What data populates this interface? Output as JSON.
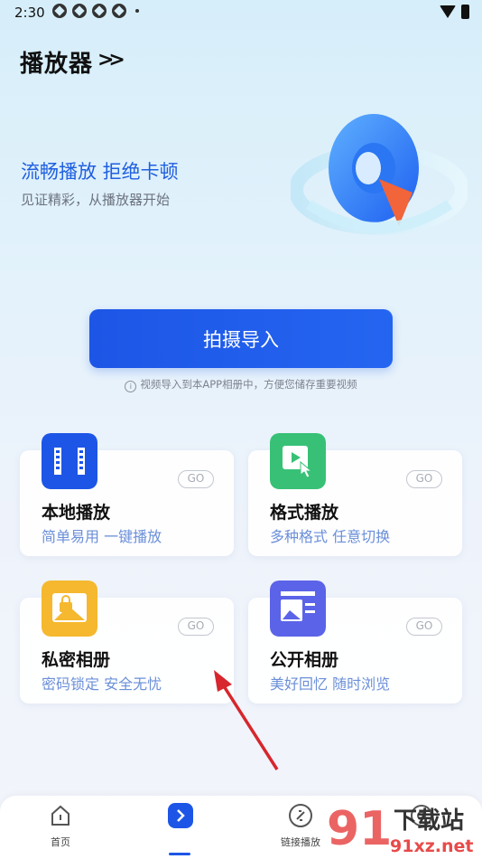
{
  "status": {
    "time": "2:30"
  },
  "header": {
    "title": "播放器",
    "title_arrows": ">>"
  },
  "hero": {
    "slogan": "流畅播放 拒绝卡顿",
    "subslogan": "见证精彩，从播放器开始"
  },
  "capture": {
    "button_label": "拍摄导入",
    "hint": "视频导入到本APP相册中，方便您储存重要视频"
  },
  "cards": [
    {
      "title": "本地播放",
      "subtitle": "简单易用 一键播放",
      "badge": "GO",
      "icon": "film-icon",
      "color": "#1d56e6"
    },
    {
      "title": "格式播放",
      "subtitle": "多种格式 任意切换",
      "badge": "GO",
      "icon": "video-tap-icon",
      "color": "#38c176"
    },
    {
      "title": "私密相册",
      "subtitle": "密码锁定 安全无忧",
      "badge": "GO",
      "icon": "locked-photo-icon",
      "color": "#f5b82e"
    },
    {
      "title": "公开相册",
      "subtitle": "美好回忆 随时浏览",
      "badge": "GO",
      "icon": "photo-album-icon",
      "color": "#5b63e8"
    }
  ],
  "tabbar": {
    "items": [
      {
        "label": "首页",
        "icon": "home-icon"
      },
      {
        "label": "",
        "icon": "chevron-right-icon",
        "active": true
      },
      {
        "label": "链接播放",
        "icon": "link-icon"
      },
      {
        "label": "",
        "icon": "settings-icon"
      }
    ]
  },
  "watermark": {
    "text_cn": "下载站",
    "text_domain": "91xz.net"
  }
}
